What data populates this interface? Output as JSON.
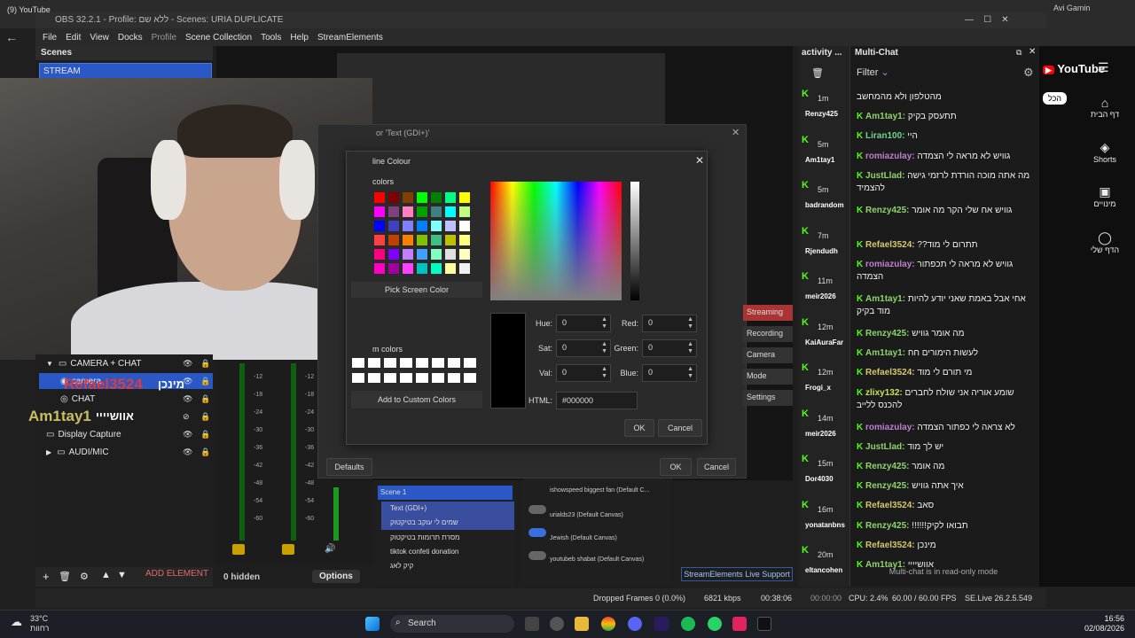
{
  "browser": {
    "tab_title": "(9) YouTube",
    "profile_label": "Avi Gamin"
  },
  "obs": {
    "title": "OBS 32.2.1 - Profile: ללא שם - Scenes: URIA DUPLICATE",
    "menu": [
      "File",
      "Edit",
      "View",
      "Docks",
      "Profile",
      "Scene Collection",
      "Tools",
      "Help",
      "StreamElements"
    ],
    "scenes_header": "Scenes",
    "scene_selected": "STREAM",
    "big_number": "6"
  },
  "sources": [
    {
      "name": "CAMERA + CHAT",
      "type": "folder"
    },
    {
      "name": "camera",
      "type": "camera"
    },
    {
      "name": "CHAT",
      "type": "browser"
    },
    {
      "name": "",
      "type": "hidden"
    },
    {
      "name": "Display Capture",
      "type": "display"
    },
    {
      "name": "AUDI/MIC",
      "type": "folder"
    }
  ],
  "overlay_names": {
    "name1": "Refael3524",
    "name1_tag": "מינכן",
    "name2": "Am1tay1",
    "name2_tag": "אוושיייי"
  },
  "source_toolbar": {
    "add_element": "ADD ELEMENT",
    "hidden_count": "0 hidden",
    "options": "Options"
  },
  "mixer_ticks": [
    "-12",
    "-18",
    "-24",
    "-30",
    "-36",
    "-42",
    "-48",
    "-54",
    "-60"
  ],
  "text_dialog": {
    "title": "or 'Text (GDI+)'",
    "defaults": "Defaults",
    "ok": "OK",
    "cancel": "Cancel"
  },
  "color_dialog": {
    "title": "line Colour",
    "basic_label": "colors",
    "pick_screen": "Pick Screen Color",
    "custom_label": "m colors",
    "add_custom": "Add to Custom Colors",
    "hue_label": "Hue:",
    "hue": "0",
    "sat_label": "Sat:",
    "sat": "0",
    "val_label": "Val:",
    "val": "0",
    "red_label": "Red:",
    "red": "0",
    "green_label": "Green:",
    "green": "0",
    "blue_label": "Blue:",
    "blue": "0",
    "html_label": "HTML:",
    "html": "#000000",
    "ok": "OK",
    "cancel": "Cancel",
    "swatch_colors": [
      "#ff0000",
      "#800000",
      "#804000",
      "#00ff00",
      "#008000",
      "#00ff80",
      "#ffff00",
      "#ff00ff",
      "#804080",
      "#ff80c0",
      "#00a000",
      "#408080",
      "#00ffff",
      "#c0ff80",
      "#0000ff",
      "#4040c0",
      "#8080ff",
      "#0080ff",
      "#80ffff",
      "#c0c0ff",
      "#ffffff",
      "#ff4040",
      "#c04000",
      "#ff8000",
      "#80c000",
      "#40c080",
      "#c0c000",
      "#ffff80",
      "#ff0080",
      "#8000ff",
      "#c080ff",
      "#40a0ff",
      "#80ffc0",
      "#e0e0e0",
      "#ffffc0",
      "#ff00c0",
      "#a000a0",
      "#ff40ff",
      "#00c0c0",
      "#00ffc0",
      "#ffffa0",
      "#f0f0f0"
    ]
  },
  "controls": [
    "Streaming",
    "Recording",
    "Camera",
    "Mode",
    "Settings"
  ],
  "scene_list": [
    "Scene 1",
    "Text (GDI+)",
    "שמים לי עוקב בטיקטוק",
    "מסרת תרומות בטיקטוק",
    "tiktok confeti donation",
    "קיק לאג"
  ],
  "mid_list": [
    "ishowspeed biggest fan (Default C...",
    "urialds23 (Default Canvas)",
    "Jewish (Default Canvas)",
    "youtubeb shabat (Default Canvas)"
  ],
  "activity": {
    "title": "activity ...",
    "items": [
      {
        "ago": "1m",
        "name": "Renzy425"
      },
      {
        "ago": "5m",
        "name": "Am1tay1"
      },
      {
        "ago": "5m",
        "name": "badrandom"
      },
      {
        "ago": "7m",
        "name": "Rjendudh"
      },
      {
        "ago": "11m",
        "name": "meir2026"
      },
      {
        "ago": "12m",
        "name": "KaiAuraFar"
      },
      {
        "ago": "12m",
        "name": "Frogi_x"
      },
      {
        "ago": "14m",
        "name": "meir2026"
      },
      {
        "ago": "15m",
        "name": "Dor4030"
      },
      {
        "ago": "16m",
        "name": "yonatanbns"
      },
      {
        "ago": "20m",
        "name": "eltancohen"
      }
    ]
  },
  "multichat": {
    "title": "Multi-Chat",
    "filter": "Filter",
    "readonly": "Multi-chat is in read-only mode",
    "messages": [
      {
        "user": "",
        "text": "מהטלפון ולא מהמחשב",
        "color": "#eeeeee"
      },
      {
        "user": "Am1tay1:",
        "text": "תתעסק בקיק",
        "color": "#8fd36f"
      },
      {
        "user": "Liran100:",
        "text": "היי",
        "color": "#6fd38f"
      },
      {
        "user": "romiazulay:",
        "text": "גוויש לא מראה לי הצמדה",
        "color": "#c07fd0"
      },
      {
        "user": "JustLlad:",
        "text": "מה אתה מוכה הורדת לרזמי גישה להצמיד",
        "color": "#8fd36f"
      },
      {
        "user": "Renzy425:",
        "text": "גוויש אח שלי הקר מה אומר",
        "color": "#8fd36f"
      },
      {
        "user": "Refael3524:",
        "text": "??תתרום לי מוד",
        "color": "#d3c86f"
      },
      {
        "user": "romiazulay:",
        "text": "גוויש לא מראה לי תכפתור הצמדה",
        "color": "#c07fd0"
      },
      {
        "user": "Am1tay1:",
        "text": "אחי אבל באמת שאני יודע להיות מוד בקיק",
        "color": "#8fd36f"
      },
      {
        "user": "Renzy425:",
        "text": "מה אומר גוויש",
        "color": "#8fd36f"
      },
      {
        "user": "Am1tay1:",
        "text": "לעשות הימורים חח",
        "color": "#8fd36f"
      },
      {
        "user": "Refael3524:",
        "text": "מי תורם לי מוד",
        "color": "#d3c86f"
      },
      {
        "user": "zlixy132:",
        "text": "שומע אוריה אני שולח לחברים להכנס ללייב",
        "color": "#c8e060"
      },
      {
        "user": "romiazulay:",
        "text": "לא צראה לי כפתור הצמדה",
        "color": "#c07fd0"
      },
      {
        "user": "JustLlad:",
        "text": "יש לך מוד",
        "color": "#8fd36f"
      },
      {
        "user": "Renzy425:",
        "text": "מה אומר",
        "color": "#8fd36f"
      },
      {
        "user": "Renzy425:",
        "text": "איך אתה גוויש",
        "color": "#8fd36f"
      },
      {
        "user": "Refael3524:",
        "text": "סאב",
        "color": "#d3c86f"
      },
      {
        "user": "Renzy425:",
        "text": "!!!!!!תבואו לקיק",
        "color": "#8fd36f"
      },
      {
        "user": "Refael3524:",
        "text": "מינכן",
        "color": "#d3c86f"
      },
      {
        "user": "Am1tay1:",
        "text": "אוושיייי",
        "color": "#8fd36f"
      }
    ]
  },
  "youtube": {
    "logo": "YouTube",
    "chip": "הכל",
    "nav": [
      "דף הבית",
      "Shorts",
      "מינויים",
      "הדף שלי"
    ]
  },
  "status": {
    "support": "StreamElements Live Support",
    "dropped": "Dropped Frames 0 (0.0%)",
    "kbps": "6821 kbps",
    "stream_time": "00:38:06",
    "rec_time": "00:00:00",
    "cpu": "CPU: 2.4%",
    "fps": "60.00 / 60.00 FPS",
    "se_version": "SE.Live 26.2.5.549"
  },
  "taskbar": {
    "temp": "33°C",
    "weather": "רחוות",
    "search": "Search",
    "time": "16:56",
    "date": "02/08/2026"
  }
}
